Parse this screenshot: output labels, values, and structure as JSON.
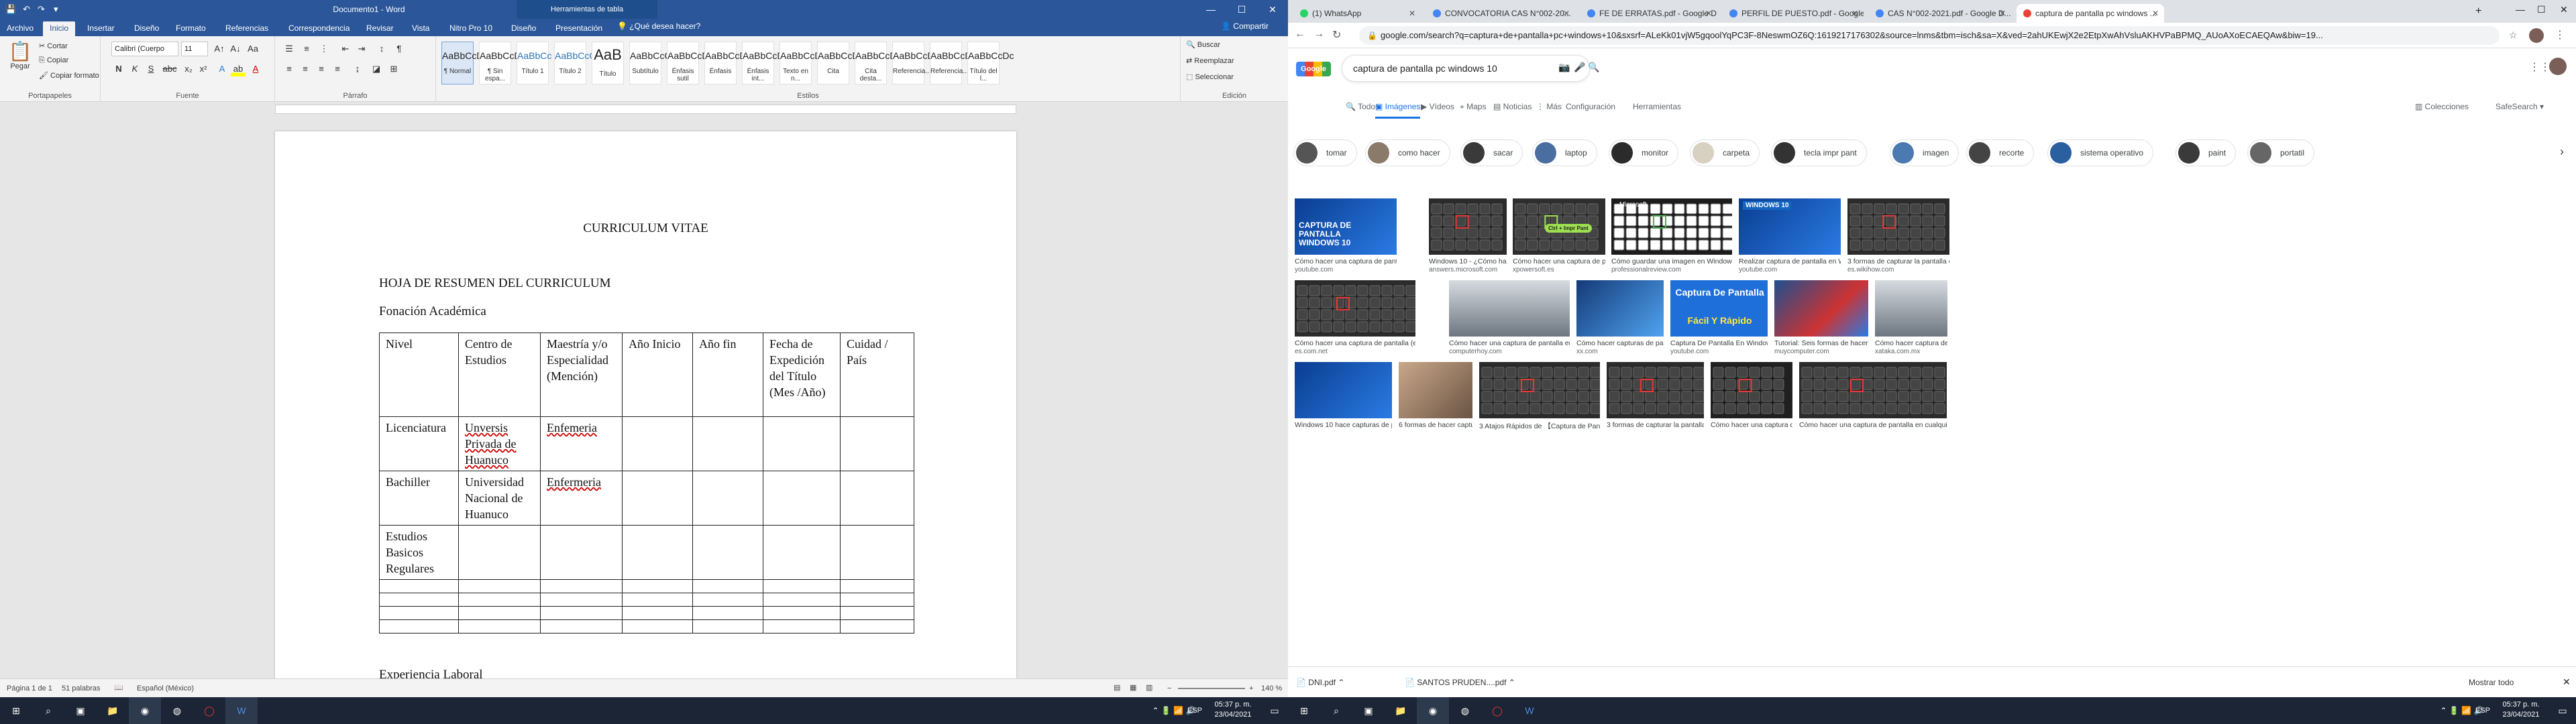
{
  "word": {
    "title": "Documento1 - Word",
    "tools_title": "Herramientas de tabla",
    "tabs": [
      "Archivo",
      "Inicio",
      "Insertar",
      "Diseño",
      "Formato",
      "Referencias",
      "Correspondencia",
      "Revisar",
      "Vista",
      "Nitro Pro 10",
      "Diseño",
      "Presentación"
    ],
    "tell_me": "¿Qué desea hacer?",
    "share": "Compartir",
    "clipboard": {
      "paste": "Pegar",
      "cut": "Cortar",
      "copy": "Copiar",
      "format_painter": "Copiar formato",
      "label": "Portapapeles"
    },
    "font": {
      "name": "Calibri (Cuerpo",
      "size": "11",
      "label": "Fuente"
    },
    "paragraph_label": "Párrafo",
    "styles_label": "Estilos",
    "styles": [
      {
        "preview": "AaBbCcDc",
        "label": "¶ Normal"
      },
      {
        "preview": "AaBbCcDc",
        "label": "¶ Sin espa..."
      },
      {
        "preview": "AaBbCc",
        "label": "Título 1"
      },
      {
        "preview": "AaBbCcC",
        "label": "Título 2"
      },
      {
        "preview": "AaB",
        "label": "Título"
      },
      {
        "preview": "AaBbCcC",
        "label": "Subtítulo"
      },
      {
        "preview": "AaBbCcDc",
        "label": "Énfasis sutil"
      },
      {
        "preview": "AaBbCcDc",
        "label": "Énfasis"
      },
      {
        "preview": "AaBbCcDc",
        "label": "Énfasis int..."
      },
      {
        "preview": "AaBbCcDc",
        "label": "Texto en n..."
      },
      {
        "preview": "AaBbCcDc",
        "label": "Cita"
      },
      {
        "preview": "AaBbCcDc",
        "label": "Cita desta..."
      },
      {
        "preview": "AaBbCcDc",
        "label": "Referencia..."
      },
      {
        "preview": "AaBbCcDc",
        "label": "Referencia..."
      },
      {
        "preview": "AaBbCcDc",
        "label": "Título del l..."
      }
    ],
    "editing": {
      "find": "Buscar",
      "replace": "Reemplazar",
      "select": "Seleccionar",
      "label": "Edición"
    },
    "doc": {
      "title": "CURRICULUM VITAE",
      "summary": "HOJA DE RESUMEN DEL CURRICULUM",
      "section": "Fonación Académica",
      "next_section": "Experiencia Laboral",
      "headers": [
        "Nivel",
        "Centro de Estudios",
        "Maestría y/o Especialidad (Mención)",
        "Año Inicio",
        "Año fin",
        "Fecha de Expedición del Título (Mes /Año)",
        "Cuidad / País"
      ],
      "rows": [
        [
          "Licenciatura",
          "Unversis Privada de Huanuco",
          "Enfemeria",
          "",
          "",
          "",
          ""
        ],
        [
          "Bachiller",
          "Universidad Nacional de Huanuco",
          "Enfermeria",
          "",
          "",
          "",
          ""
        ],
        [
          "Estudios Basicos Regulares",
          "",
          "",
          "",
          "",
          "",
          ""
        ],
        [
          "",
          "",
          "",
          "",
          "",
          "",
          ""
        ],
        [
          "",
          "",
          "",
          "",
          "",
          "",
          ""
        ],
        [
          "",
          "",
          "",
          "",
          "",
          "",
          ""
        ],
        [
          "",
          "",
          "",
          "",
          "",
          "",
          ""
        ]
      ]
    },
    "status": {
      "page": "Página 1 de 1",
      "words": "51 palabras",
      "language": "Español (México)",
      "zoom": "140 %"
    }
  },
  "chrome": {
    "tabs": [
      {
        "title": "(1) WhatsApp",
        "color": "#25d366"
      },
      {
        "title": "CONVOCATORIA CAS N°002-20...",
        "color": "#4285f4"
      },
      {
        "title": "FE DE ERRATAS.pdf - Google D...",
        "color": "#4285f4"
      },
      {
        "title": "PERFIL DE PUESTO.pdf - Google...",
        "color": "#4285f4"
      },
      {
        "title": "CAS N°002-2021.pdf - Google D...",
        "color": "#4285f4"
      },
      {
        "title": "captura de pantalla pc windows ...",
        "color": "#ea4335"
      }
    ],
    "url": "google.com/search?q=captura+de+pantalla+pc+windows+10&sxsrf=ALeKk01vjW5gqoolYqPC3F-8NeswmOZ6Q:1619217176302&source=lnms&tbm=isch&sa=X&ved=2ahUKEwjX2e2EtpXwAhVsluAKHVPaBPMQ_AUoAXoECAEQAw&biw=19...",
    "logo": "Google",
    "query": "captura de pantalla pc windows 10",
    "search_tabs": [
      "Todos",
      "Imágenes",
      "Vídeos",
      "Maps",
      "Noticias",
      "Más",
      "Configuración",
      "Herramientas"
    ],
    "collections": "Colecciones",
    "safesearch": "SafeSearch",
    "chips": [
      "tomar",
      "como hacer",
      "sacar",
      "laptop",
      "monitor",
      "carpeta",
      "tecla impr pant",
      "imagen",
      "recorte",
      "sistema operativo",
      "paint",
      "portatil"
    ],
    "results": [
      {
        "caption": "Cómo hacer una captura de pantalla en windows 1...",
        "source": "youtube.com",
        "thumb_text": "CAPTURA DE PANTALLA WINDOWS 10"
      },
      {
        "caption": "Windows 10 - ¿Cómo hacer captura de ...",
        "source": "answers.microsoft.com"
      },
      {
        "caption": "Cómo hacer una captura de pantalla en Windo...",
        "source": "xpowersoft.es",
        "thumb_text": "Ctrl + Impr Pant"
      },
      {
        "caption": "Cómo guardar una imagen en Windows 10",
        "source": "professionalreview.com",
        "thumb_text": "Microsoft"
      },
      {
        "caption": "Realizar captura de pantalla en Windows 10 - YouT...",
        "source": "youtube.com",
        "thumb_text": "WINDOWS 10"
      },
      {
        "caption": "3 formas de capturar la pantalla en Windows - wiki...",
        "source": "es.wikihow.com"
      },
      {
        "caption": "Cómo hacer una captura de pantalla (en PC, iPhone o Android...",
        "source": "es.com.net"
      },
      {
        "caption": "Cómo hacer una captura de pantalla en cualquier versión de ...",
        "source": "computerhoy.com"
      },
      {
        "caption": "Cómo hacer capturas de pantalla con el nue...",
        "source": "xx.com"
      },
      {
        "caption": "Captura De Pantalla En Windows 10 en 2020- Fác...",
        "source": "youtube.com",
        "thumb_text": "Captura De Pantalla",
        "thumb_text2": "Fácil Y Rápido"
      },
      {
        "caption": "Tutorial: Seis formas de hacer capturas de pant...",
        "source": "muycomputer.com"
      },
      {
        "caption": "Cómo hacer captura de m...",
        "source": "xataka.com.mx"
      },
      {
        "caption": "Windows 10 hace capturas de pantalla de tu PC s...",
        "source": ""
      },
      {
        "caption": "6 formas de hacer captura de pantall...",
        "source": ""
      },
      {
        "caption": "3 Atajos Rápidos de 【Captura de Pantalla】 en Windows 10",
        "source": ""
      },
      {
        "caption": "3 formas de capturar la pantalla en Windows - wi...",
        "source": ""
      },
      {
        "caption": "Cómo hacer una captura de pantalla en P...",
        "source": ""
      },
      {
        "caption": "Cómo hacer una captura de pantalla en cualquier versión de ...",
        "source": ""
      }
    ],
    "downloads": [
      "DNI.pdf",
      "SANTOS PRUDEN....pdf"
    ],
    "show_all": "Mostrar todo"
  },
  "taskbar": {
    "left": {
      "language": "ESP",
      "time": "05:37 p. m.",
      "date": "23/04/2021"
    },
    "right": {
      "language": "ESP",
      "time": "05:37 p. m.",
      "date": "23/04/2021"
    }
  }
}
